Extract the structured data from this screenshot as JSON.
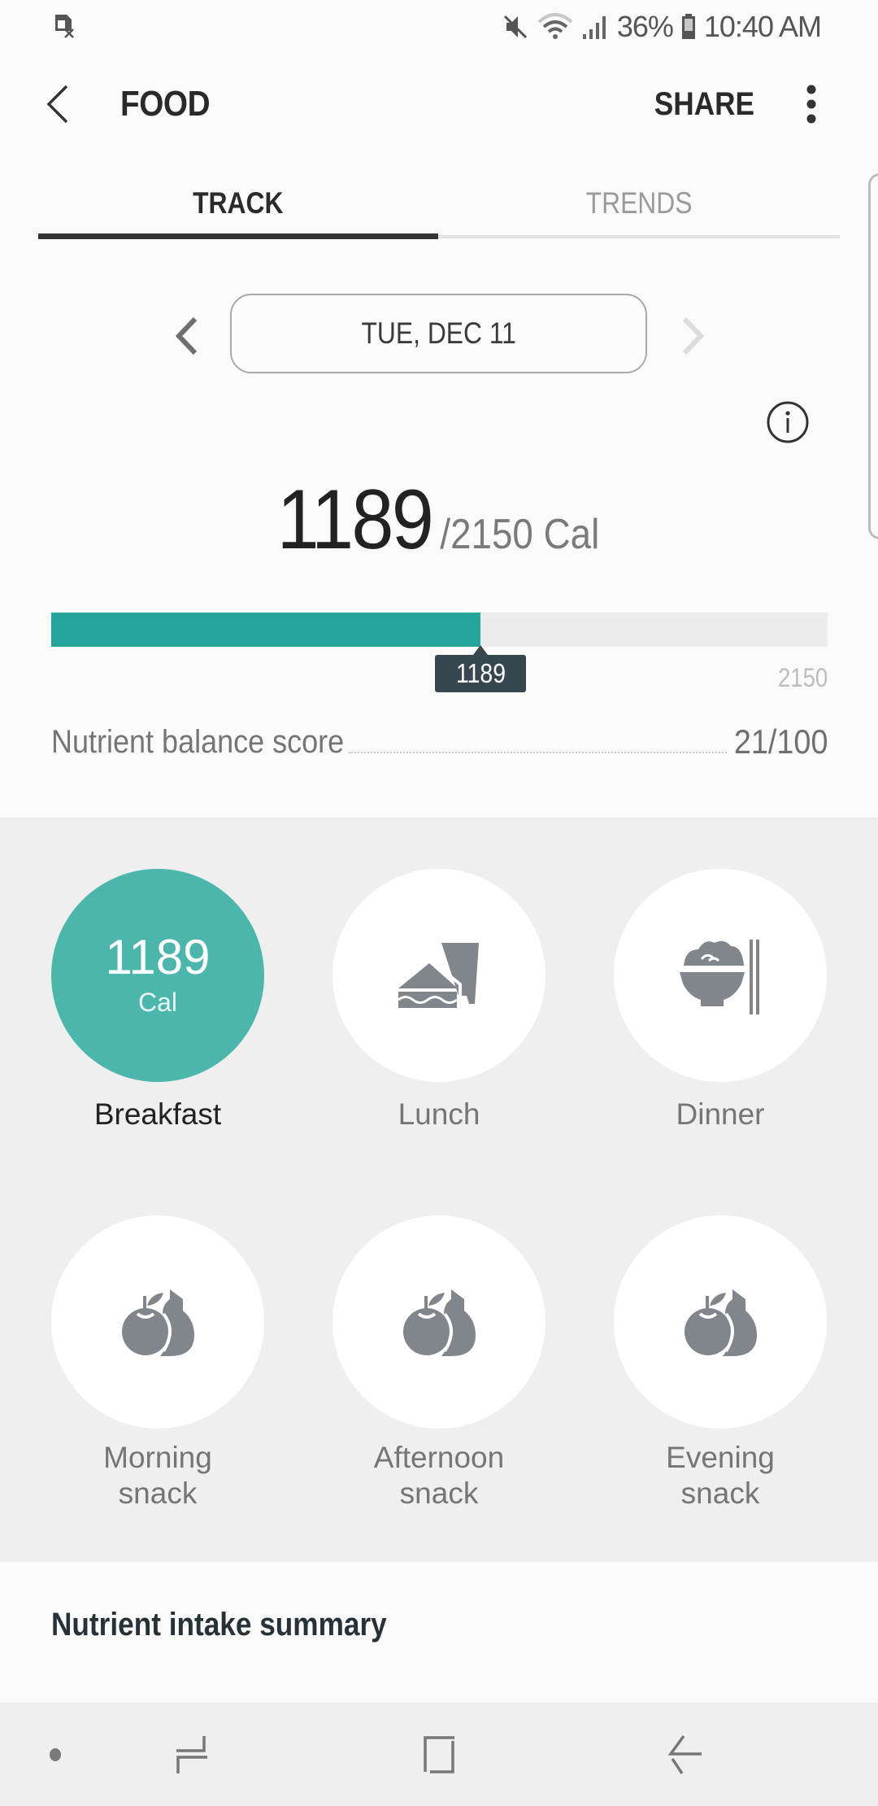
{
  "status_bar": {
    "sim_icon": "no-sim-icon",
    "icons": [
      "mute-icon",
      "wifi-icon",
      "signal-icon"
    ],
    "battery_percent": "36%",
    "battery_icon": "battery-icon",
    "time": "10:40 AM"
  },
  "app_bar": {
    "back_icon": "back-arrow-icon",
    "title": "FOOD",
    "share_label": "SHARE",
    "more_icon": "more-vert-icon"
  },
  "tabs": [
    {
      "label": "TRACK",
      "selected": true
    },
    {
      "label": "TRENDS",
      "selected": false
    }
  ],
  "date_selector": {
    "prev_icon": "chevron-left-icon",
    "date": "TUE, DEC 11",
    "next_icon": "chevron-right-icon",
    "next_enabled": false
  },
  "info_icon": "info-icon",
  "calories": {
    "consumed": "1189",
    "goal_text": "/2150",
    "unit": "Cal",
    "consumed_value": 1189,
    "goal_value": 2150,
    "tooltip": "1189",
    "max_label": "2150"
  },
  "nutrient_balance": {
    "label": "Nutrient balance score",
    "value": "21/100"
  },
  "meals": [
    {
      "label": "Breakfast",
      "active": true,
      "calories": "1189",
      "unit": "Cal",
      "icon": "breakfast-calories"
    },
    {
      "label": "Lunch",
      "active": false,
      "icon": "sandwich-drink-icon"
    },
    {
      "label": "Dinner",
      "active": false,
      "icon": "rice-bowl-chopsticks-icon"
    },
    {
      "label": "Morning snack",
      "line1": "Morning",
      "line2": "snack",
      "active": false,
      "icon": "fruit-icon"
    },
    {
      "label": "Afternoon snack",
      "line1": "Afternoon",
      "line2": "snack",
      "active": false,
      "icon": "fruit-icon"
    },
    {
      "label": "Evening snack",
      "line1": "Evening",
      "line2": "snack",
      "active": false,
      "icon": "fruit-icon"
    }
  ],
  "nutrient_intake": {
    "title": "Nutrient intake summary"
  },
  "nav_bar": {
    "buttons": [
      "nav-dot",
      "recent-apps-icon",
      "home-icon",
      "back-icon"
    ]
  },
  "colors": {
    "accent": "#26a69a",
    "meal_active": "#4db6ac",
    "tooltip_bg": "#37474f",
    "icon_grey": "#80868b"
  }
}
